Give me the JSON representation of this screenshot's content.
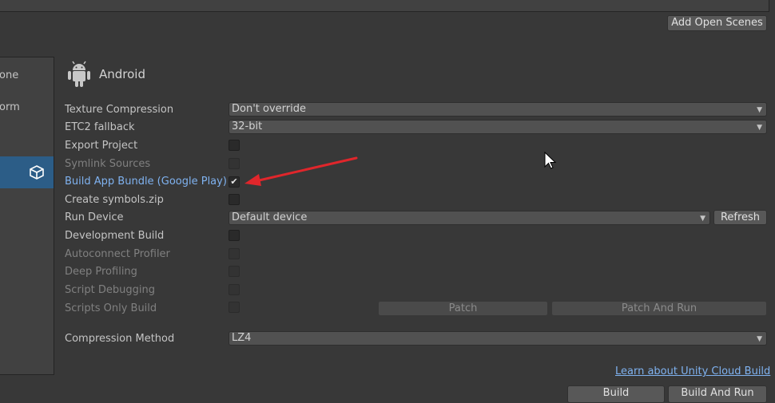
{
  "scenes": {
    "add_open_scenes_label": "Add Open Scenes"
  },
  "platforms": {
    "items": [
      {
        "label": "one"
      },
      {
        "label": "orm"
      }
    ]
  },
  "platform_header": {
    "title": "Android"
  },
  "settings": {
    "texture_compression": {
      "label": "Texture Compression",
      "value": "Don't override"
    },
    "etc2_fallback": {
      "label": "ETC2 fallback",
      "value": "32-bit"
    },
    "export_project": {
      "label": "Export Project",
      "checked": false
    },
    "symlink_sources": {
      "label": "Symlink Sources",
      "checked": false
    },
    "build_app_bundle": {
      "label": "Build App Bundle (Google Play)",
      "checked": true
    },
    "create_symbols": {
      "label": "Create symbols.zip",
      "checked": false
    },
    "run_device": {
      "label": "Run Device",
      "value": "Default device",
      "refresh_label": "Refresh"
    },
    "development_build": {
      "label": "Development Build",
      "checked": false
    },
    "autoconnect_profiler": {
      "label": "Autoconnect Profiler",
      "checked": false
    },
    "deep_profiling": {
      "label": "Deep Profiling",
      "checked": false
    },
    "script_debugging": {
      "label": "Script Debugging",
      "checked": false
    },
    "scripts_only_build": {
      "label": "Scripts Only Build",
      "checked": false
    },
    "patch_label": "Patch",
    "patch_and_run_label": "Patch And Run",
    "compression_method": {
      "label": "Compression Method",
      "value": "LZ4"
    }
  },
  "footer": {
    "cloud_link": "Learn about Unity Cloud Build",
    "build_label": "Build",
    "build_and_run_label": "Build And Run"
  },
  "colors": {
    "background": "#383838",
    "selection": "#2c5d87",
    "link": "#7fb2f0",
    "annotation_arrow": "#e0262b"
  },
  "icons": [
    "android-icon",
    "unity-icon",
    "dropdown-arrow-icon",
    "checkmark-icon",
    "mouse-cursor-icon",
    "red-arrow-annotation"
  ]
}
